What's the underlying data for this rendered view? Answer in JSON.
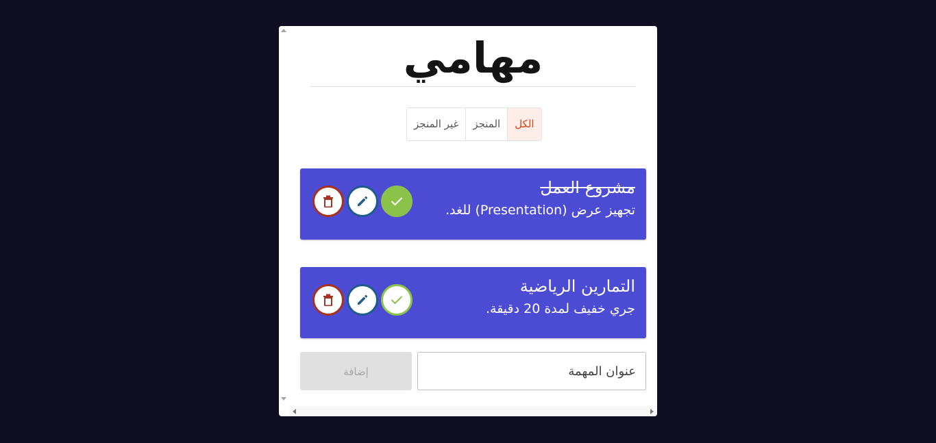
{
  "app": {
    "title": "مهامي"
  },
  "filters": [
    {
      "label": "الكل",
      "active": true
    },
    {
      "label": "المنجز",
      "active": false
    },
    {
      "label": "غير المنجز",
      "active": false
    }
  ],
  "tasks": [
    {
      "title": "مشروع العمل",
      "description": "تجهيز عرض (Presentation) للغد.",
      "completed": true
    },
    {
      "title": "التمارين الرياضية",
      "description": "جري خفيف لمدة 20 دقيقة.",
      "completed": false
    }
  ],
  "task_icons": [
    "delete-icon",
    "edit-icon",
    "check-icon"
  ],
  "add_form": {
    "input_placeholder": "عنوان المهمة",
    "button_label": "إضافة"
  },
  "colors": {
    "background": "#0f0d22",
    "card": "#ffffff",
    "task": "#4c4bd3",
    "active_filter": "#d9421a",
    "delete": "#a83221",
    "edit": "#1f5b8c",
    "check": "#8bc34a"
  }
}
